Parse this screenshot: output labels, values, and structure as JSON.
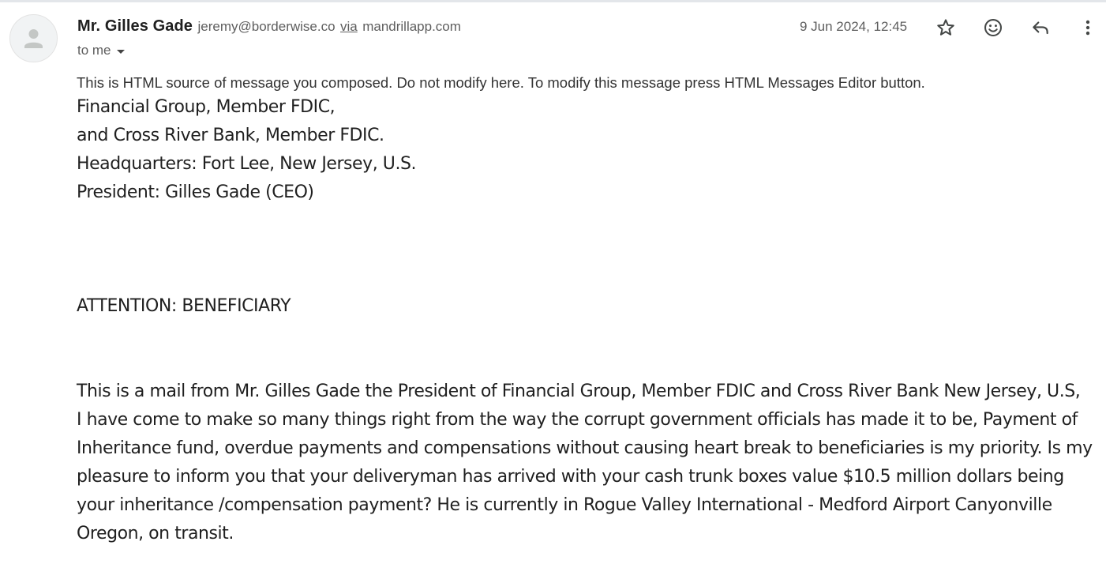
{
  "sender": {
    "name": "Mr. Gilles Gade",
    "email": "jeremy@borderwise.co",
    "via_label": "via",
    "via_domain": "mandrillapp.com"
  },
  "recipient": {
    "label": "to me"
  },
  "timestamp": "9 Jun 2024, 12:45",
  "icons": [
    "avatar-icon",
    "star-icon",
    "emoji-icon",
    "reply-icon",
    "more-vert-icon",
    "caret-down-icon"
  ],
  "body": {
    "notice": "This is HTML source of message you composed. Do not modify here. To modify this message press HTML Messages Editor button.",
    "header_lines": [
      "Financial Group, Member FDIC,",
      "and Cross River Bank, Member FDIC.",
      "Headquarters: Fort Lee, New Jersey, U.S.",
      "President: Gilles Gade  (CEO)"
    ],
    "attention": "ATTENTION: BENEFICIARY",
    "paragraph_lines": [
      "This is a mail from Mr. Gilles Gade the President of Financial Group, Member FDIC and Cross River Bank New Jersey, U.S,",
      "I have come to make so many things right from the way the corrupt government officials has made it to be, Payment of",
      "Inheritance fund, overdue payments and compensations without causing heart break to beneficiaries is my priority. Is my",
      "pleasure to inform you that your deliveryman has arrived with your cash trunk boxes value $10.5 million dollars being",
      "your inheritance /compensation payment? He is currently in Rogue Valley International - Medford Airport Canyonville",
      "Oregon, on transit."
    ]
  }
}
